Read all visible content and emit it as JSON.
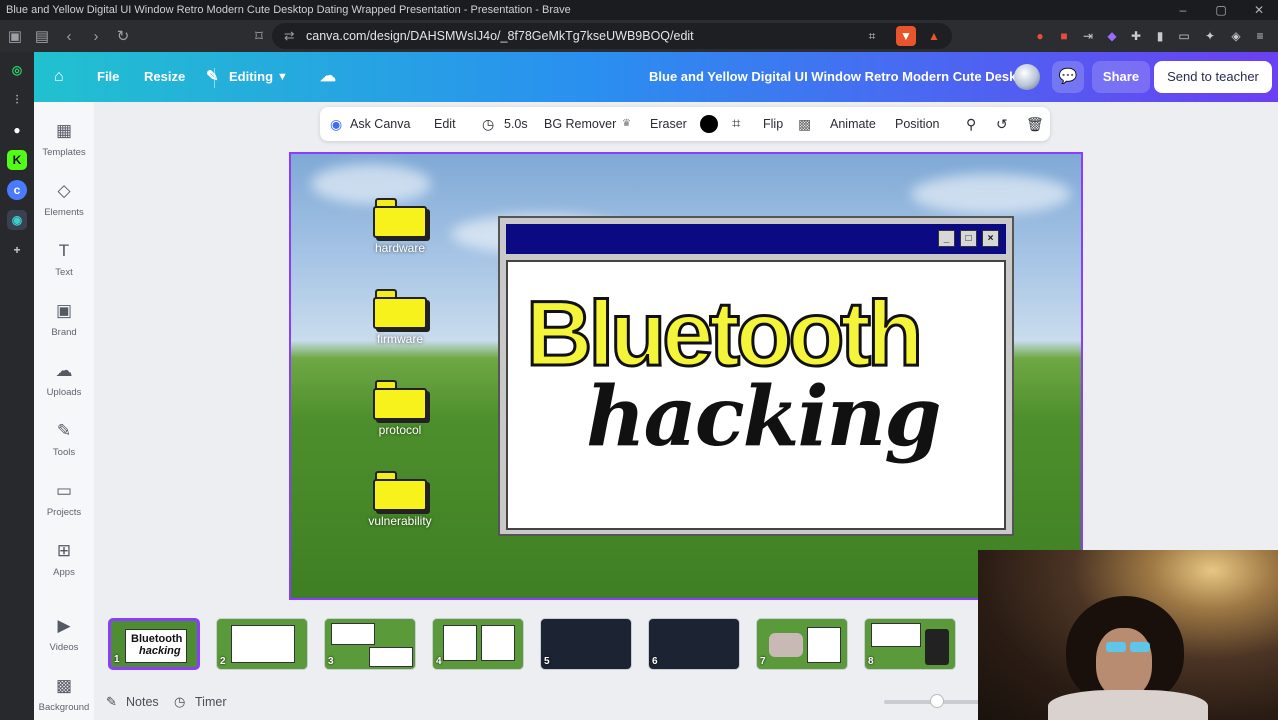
{
  "browser": {
    "window_title": "Blue and Yellow Digital UI Window Retro Modern Cute Desktop Dating Wrapped Presentation - Presentation - Brave",
    "url": "canva.com/design/DAHSMWsIJ4o/_8f78GeMkTg7kseUWB9BOQ/edit"
  },
  "canva_header": {
    "file": "File",
    "resize": "Resize",
    "editing": "Editing",
    "doc_title": "Blue and Yellow Digital UI Window Retro Modern Cute Desk...",
    "share": "Share",
    "send": "Send to teacher"
  },
  "sidebar": {
    "items": [
      {
        "label": "Templates",
        "icon": "templates-icon"
      },
      {
        "label": "Elements",
        "icon": "elements-icon"
      },
      {
        "label": "Text",
        "icon": "text-icon"
      },
      {
        "label": "Brand",
        "icon": "brand-icon"
      },
      {
        "label": "Uploads",
        "icon": "uploads-icon"
      },
      {
        "label": "Tools",
        "icon": "tools-icon"
      },
      {
        "label": "Projects",
        "icon": "projects-icon"
      },
      {
        "label": "Apps",
        "icon": "apps-icon"
      },
      {
        "label": "Videos",
        "icon": "videos-icon"
      },
      {
        "label": "Background",
        "icon": "background-icon"
      }
    ]
  },
  "toolbar": {
    "ask_canva": "Ask Canva",
    "edit": "Edit",
    "duration": "5.0s",
    "bg_remover": "BG Remover",
    "eraser": "Eraser",
    "flip": "Flip",
    "animate": "Animate",
    "position": "Position"
  },
  "slide": {
    "folders": [
      "hardware",
      "firmware",
      "protocol",
      "vulnerability"
    ],
    "title": "Bluetooth",
    "subtitle": "hacking"
  },
  "thumbnails": [
    {
      "num": "1",
      "bg": "#4f8d33"
    },
    {
      "num": "2",
      "bg": "#5a9a3a"
    },
    {
      "num": "3",
      "bg": "#5a9a3a"
    },
    {
      "num": "4",
      "bg": "#5a9a3a"
    },
    {
      "num": "5",
      "bg": "#1c2433"
    },
    {
      "num": "6",
      "bg": "#1c2433"
    },
    {
      "num": "7",
      "bg": "#5a9a3a"
    },
    {
      "num": "8",
      "bg": "#5a9a3a"
    }
  ],
  "bottom": {
    "notes": "Notes",
    "timer": "Timer"
  },
  "colors": {
    "canva_purple": "#8b3dff",
    "folder_yellow": "#f7f21c",
    "window_titlebar": "#0c0a83"
  }
}
